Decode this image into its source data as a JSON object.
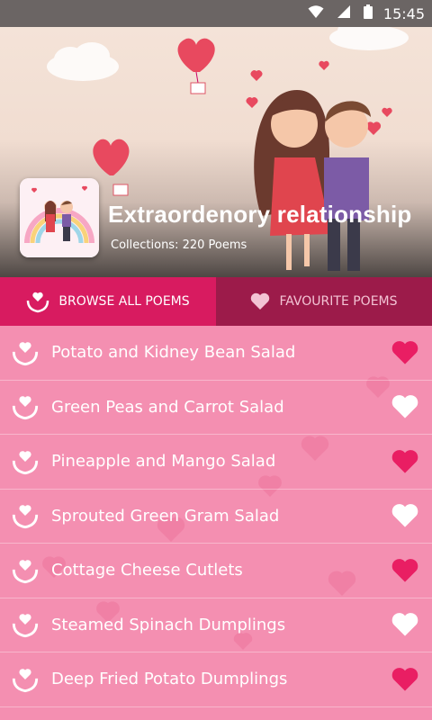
{
  "status": {
    "time": "15:45"
  },
  "header": {
    "title": "Extraordenory relationship",
    "subtitle": "Collections: 220 Poems"
  },
  "tabs": [
    {
      "label": "BROWSE ALL POEMS",
      "active": true,
      "icon": "hand-heart-icon"
    },
    {
      "label": "FAVOURITE POEMS",
      "active": false,
      "icon": "heart-icon"
    }
  ],
  "poems": [
    {
      "title": "Potato and Kidney Bean Salad",
      "favourite": true
    },
    {
      "title": "Green Peas and Carrot Salad",
      "favourite": false
    },
    {
      "title": "Pineapple and Mango Salad",
      "favourite": true
    },
    {
      "title": "Sprouted Green Gram Salad",
      "favourite": false
    },
    {
      "title": "Cottage Cheese Cutlets",
      "favourite": true
    },
    {
      "title": "Steamed Spinach Dumplings",
      "favourite": false
    },
    {
      "title": "Deep Fried Potato Dumplings",
      "favourite": true
    }
  ],
  "colors": {
    "accent": "#d81b60",
    "tab_inactive": "#9c1b4a",
    "list_bg": "#f48fb1",
    "fav_on": "#e91e63",
    "fav_off": "#ffffff"
  }
}
